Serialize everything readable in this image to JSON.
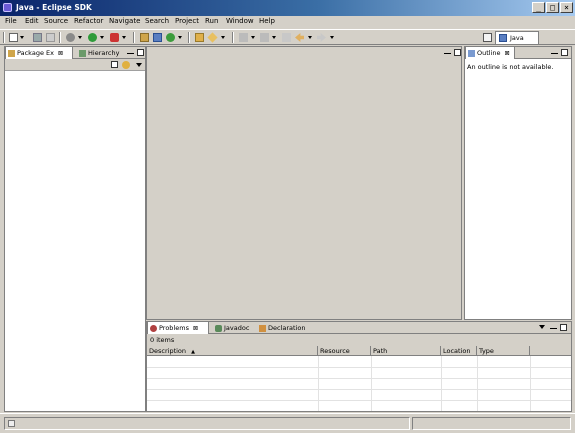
{
  "window": {
    "title": "Java - Eclipse SDK",
    "controls": {
      "minimize": "_",
      "maximize": "□",
      "close": "×"
    }
  },
  "menu": [
    "File",
    "Edit",
    "Source",
    "Refactor",
    "Navigate",
    "Search",
    "Project",
    "Run",
    "Window",
    "Help"
  ],
  "perspective": {
    "label": "Java"
  },
  "left_view": {
    "tabs": [
      {
        "label": "Package Ex",
        "close": "⊠"
      },
      {
        "label": "Hierarchy"
      }
    ]
  },
  "outline_view": {
    "tab": {
      "label": "Outline",
      "close": "⊠"
    },
    "message": "An outline is not available."
  },
  "bottom_view": {
    "tabs": [
      {
        "label": "Problems",
        "close": "⊠"
      },
      {
        "label": "Javadoc"
      },
      {
        "label": "Declaration"
      }
    ],
    "item_count": "0 items",
    "columns": [
      "Description",
      "Resource",
      "Path",
      "Location",
      "Type"
    ],
    "sort_indicator": "▲"
  },
  "colors": {
    "titlebar_start": "#0a246a",
    "titlebar_end": "#a6caf0",
    "face": "#d4d0c8"
  }
}
